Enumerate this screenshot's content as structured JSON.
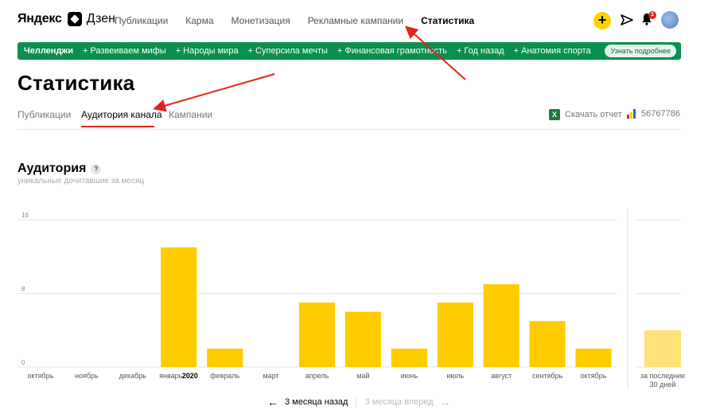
{
  "header": {
    "logo_ya": "Яндекс",
    "logo_zen": "Дзен",
    "nav": [
      "Публикации",
      "Карма",
      "Монетизация",
      "Рекламные кампании",
      "Статистика"
    ],
    "active_nav": "Статистика",
    "plus_label": "+",
    "notification_count": "1",
    "icons": [
      "plus-icon",
      "send-icon",
      "bell-icon",
      "avatar"
    ]
  },
  "challenge_bar": {
    "title": "Челленджи",
    "items": [
      "+ Развеиваем мифы",
      "+ Народы мира",
      "+ Суперсила мечты",
      "+ Финансовая грамотность",
      "+ Год назад",
      "+ Анатомия спорта"
    ],
    "more": "Узнать подробнее",
    "color": "#0b8f4f"
  },
  "page": {
    "title": "Статистика",
    "tabs": [
      "Публикации",
      "Аудитория канала",
      "Кампании"
    ],
    "active_tab": "Аудитория канала",
    "download": "Скачать отчет",
    "xls_icon": "X",
    "channel_id": "56767786"
  },
  "audience": {
    "title": "Аудитория",
    "help": "?",
    "subtitle": "уникальные дочитавшие за месяц"
  },
  "chart_data": {
    "type": "bar",
    "categories": [
      "октябрь",
      "ноябрь",
      "декабрь",
      "январь",
      "февраль",
      "март",
      "апрель",
      "май",
      "июнь",
      "июль",
      "август",
      "сентябрь",
      "октябрь"
    ],
    "year_marker": {
      "index": 3,
      "text": "2020"
    },
    "values": [
      0,
      0,
      0,
      13,
      2,
      0,
      7,
      6,
      2,
      7,
      9,
      5,
      2
    ],
    "ylim": [
      0,
      16
    ],
    "yticks": [
      0,
      8,
      16
    ],
    "bar_color": "#ffcc00",
    "last30": {
      "label_line1": "за последние",
      "label_line2": "30 дней",
      "value": 4,
      "color": "#ffe27a"
    },
    "grid": true,
    "title": "",
    "xlabel": "",
    "ylabel": ""
  },
  "pager": {
    "back": "3 месяца назад",
    "forward": "3 месяца вперед",
    "back_arrow": "←",
    "forward_arrow": "→"
  },
  "annotation_color": "#e0251d"
}
